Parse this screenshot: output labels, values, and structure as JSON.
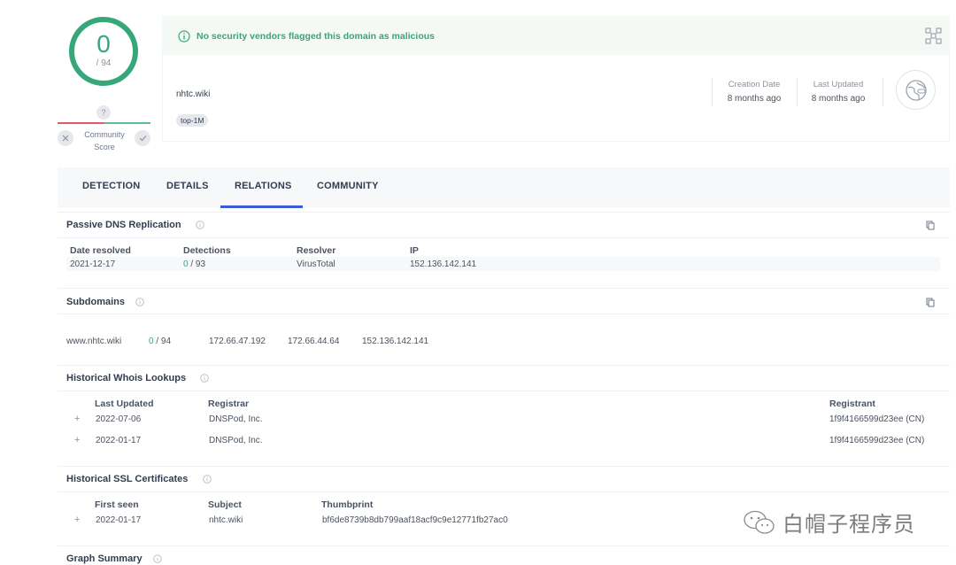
{
  "score": {
    "value": "0",
    "total": "/ 94"
  },
  "community": {
    "question": "?",
    "label": "Community Score"
  },
  "banner": {
    "text": "No security vendors flagged this domain as malicious"
  },
  "domain": {
    "name": "nhtc.wiki",
    "tag": "top-1M"
  },
  "meta": {
    "creation_label": "Creation Date",
    "creation_value": "8 months ago",
    "updated_label": "Last Updated",
    "updated_value": "8 months ago"
  },
  "tabs": [
    {
      "label": "DETECTION"
    },
    {
      "label": "DETAILS"
    },
    {
      "label": "RELATIONS",
      "active": true
    },
    {
      "label": "COMMUNITY"
    }
  ],
  "passive_dns": {
    "title": "Passive DNS Replication",
    "headers": [
      "Date resolved",
      "Detections",
      "Resolver",
      "IP"
    ],
    "rows": [
      {
        "date": "2021-12-17",
        "det_pos": "0",
        "det_total": "/ 93",
        "resolver": "VirusTotal",
        "ip": "152.136.142.141"
      }
    ]
  },
  "subdomains": {
    "title": "Subdomains",
    "rows": [
      {
        "domain": "www.nhtc.wiki",
        "det_pos": "0",
        "det_total": "/ 94",
        "ip1": "172.66.47.192",
        "ip2": "172.66.44.64",
        "ip3": "152.136.142.141"
      }
    ]
  },
  "whois": {
    "title": "Historical Whois Lookups",
    "headers": [
      "Last Updated",
      "Registrar",
      "Registrant"
    ],
    "rows": [
      {
        "updated": "2022-07-06",
        "registrar": "DNSPod, Inc.",
        "registrant": "1f9f4166599d23ee (CN)"
      },
      {
        "updated": "2022-01-17",
        "registrar": "DNSPod, Inc.",
        "registrant": "1f9f4166599d23ee (CN)"
      }
    ]
  },
  "ssl": {
    "title": "Historical SSL Certificates",
    "headers": [
      "First seen",
      "Subject",
      "Thumbprint"
    ],
    "rows": [
      {
        "first_seen": "2022-01-17",
        "subject": "nhtc.wiki",
        "thumbprint": "bf6de8739b8db799aaf18acf9c9e12771fb27ac0"
      }
    ]
  },
  "graph_summary": {
    "title": "Graph Summary"
  },
  "watermark": {
    "text": "白帽子程序员"
  },
  "colors": {
    "accent_green": "#35a77a",
    "tab_accent": "#3d5ad8",
    "malicious_red": "#e25b6a"
  }
}
